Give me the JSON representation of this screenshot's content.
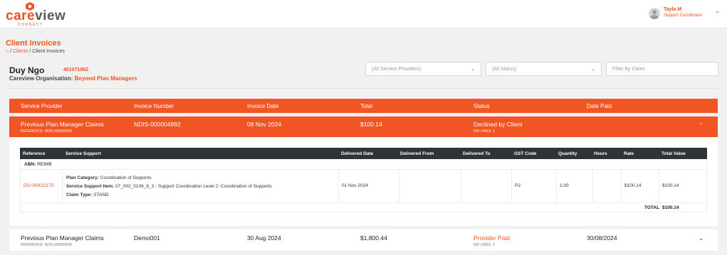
{
  "brand": {
    "word_prefix": "care",
    "word_suffix": "view",
    "sub": "CONNECT",
    "accent_color": "#f05223"
  },
  "user": {
    "name": "Tayla M",
    "role": "Support Coordinator",
    "chevron_icon": "chevron-down-icon"
  },
  "page": {
    "title": "Client Invoices",
    "breadcrumb": {
      "home_icon": "home-icon",
      "clients": "Clients",
      "current": "Client Invoices"
    }
  },
  "client": {
    "name": "Duy Ngo",
    "id": "401071982",
    "org_label": "Careview Organisation:",
    "org_name": "Beyond Plan Managers"
  },
  "filters": {
    "providers_value": "(All Service Providers)",
    "status_value": "(All Status)",
    "dates_placeholder": "Filter By Dates"
  },
  "table": {
    "headers": {
      "provider": "Service Provider",
      "number": "Invoice Number",
      "date": "Invoice Date",
      "total": "Total",
      "status": "Status",
      "paid": "Date Paid"
    },
    "rows": [
      {
        "provider": "Previous Plan Manager Claims",
        "reference": "REFERENCE: NDIS-000004992",
        "number": "NDIS-000004992",
        "date": "08 Nov 2024",
        "total": "$100.14",
        "status": "Declined by Client",
        "inv_lines": "INV LINES: 1",
        "paid": ""
      },
      {
        "provider": "Previous Plan Manager Claims",
        "reference": "REFERENCE: NDIS-000003042",
        "number": "Demo001",
        "date": "30 Aug 2024",
        "total": "$1,800.44",
        "status": "Provider Paid",
        "inv_lines": "INV LINES: 3",
        "paid": "30/08/2024"
      }
    ]
  },
  "detail": {
    "headers": {
      "reference": "Reference",
      "support": "Service Support",
      "delivered_date": "Delivered Date",
      "delivered_from": "Delivered From",
      "delivered_to": "Delivered To",
      "gst": "GST Code",
      "quantity": "Quantity",
      "hours": "Hours",
      "rate": "Rate",
      "total_value": "Total Value"
    },
    "abn_label": "ABN:",
    "abn_value": "REIMB",
    "line": {
      "reference": "DS-000011170",
      "plan_category_label": "Plan Category:",
      "plan_category": "Coordination of Supports",
      "service_item_label": "Service Support Item:",
      "service_item": "07_002_0106_8_3 - Support Coordination Level 2: Coordination of Supports",
      "claim_type_label": "Claim Type:",
      "claim_type": "STAND",
      "delivered_date": "01 Nov 2024",
      "delivered_from": "",
      "delivered_to": "",
      "gst": "P2",
      "quantity": "1.00",
      "hours": "",
      "rate": "$100.14",
      "total_value": "$100.14"
    },
    "total_label": "TOTAL",
    "total_value": "$100.14"
  }
}
